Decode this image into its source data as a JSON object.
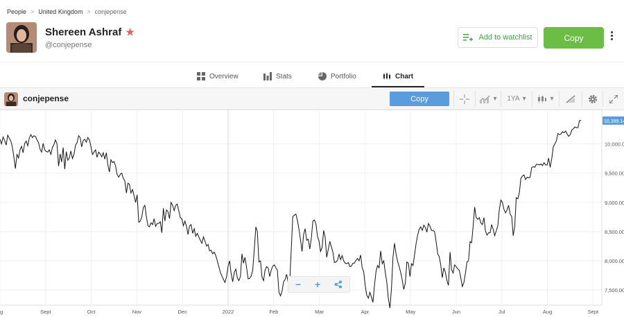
{
  "breadcrumb": {
    "items": [
      "People",
      "United Kingdom",
      "conjepense"
    ]
  },
  "profile": {
    "name": "Shereen Ashraf",
    "handle": "@conjepense"
  },
  "actions": {
    "watchlist_label": "Add to watchlist",
    "copy_label": "Copy"
  },
  "tabs": [
    {
      "label": "Overview",
      "icon": "overview-icon"
    },
    {
      "label": "Stats",
      "icon": "stats-icon"
    },
    {
      "label": "Portfolio",
      "icon": "portfolio-icon"
    },
    {
      "label": "Chart",
      "icon": "chart-icon",
      "active": true
    }
  ],
  "chart_header": {
    "title": "conjepense",
    "copy_label": "Copy",
    "period_label": "1YA",
    "tools": [
      "crosshair-icon",
      "chart-type-icon",
      "period-selector",
      "candlestick-icon",
      "draw-icon",
      "gear-icon",
      "expand-icon"
    ]
  },
  "colors": {
    "accent_green": "#6bbd46",
    "accent_blue": "#5a9cdc",
    "star": "#e0605a"
  },
  "chart_data": {
    "type": "line",
    "title": "",
    "xlabel": "",
    "ylabel": "",
    "x_ticks": [
      "g",
      "Sept",
      "Oct",
      "Nov",
      "Dec",
      "2022",
      "Feb",
      "Mar",
      "Apr",
      "May",
      "Jun",
      "Jul",
      "Aug",
      "Sept"
    ],
    "y_ticks": [
      "10,000.00",
      "9,500.00",
      "9,000.00",
      "8,500.00",
      "8,000.00",
      "7,500.00"
    ],
    "current_value_label": "10,399.14",
    "ylim": [
      7240,
      10600
    ],
    "series": [
      {
        "values": [
          10080,
          10000,
          10120,
          10060,
          9980,
          10150,
          10100,
          10050,
          9950,
          9780,
          9580,
          9820,
          9760,
          9900,
          9960,
          9850,
          10010,
          10050,
          9970,
          10100,
          10160,
          10110,
          10140,
          10130,
          10070,
          10020,
          9910,
          9860,
          10010,
          9900,
          9870,
          9860,
          9900,
          9820,
          9940,
          9990,
          10070,
          10000,
          9620,
          9830,
          9690,
          9940,
          9570,
          9870,
          9720,
          9760,
          9880,
          9750,
          9820,
          9980,
          10020,
          10140,
          10110,
          9950,
          10060,
          10080,
          10030,
          10110,
          10070,
          9960,
          9820,
          9860,
          9900,
          9770,
          9860,
          9830,
          9780,
          9850,
          9740,
          9850,
          9640,
          9520,
          9730,
          9680,
          9700,
          9620,
          9480,
          9430,
          9480,
          9500,
          9410,
          9370,
          9160,
          9330,
          9310,
          9160,
          9220,
          9110,
          9000,
          9130,
          8660,
          8680,
          8750,
          8910,
          8950,
          8750,
          8600,
          8580,
          8650,
          8620,
          8720,
          8590,
          8640,
          8640,
          8670,
          8480,
          8900,
          8680,
          8870,
          8840,
          8720,
          9000,
          8950,
          8860,
          8950,
          8970,
          8860,
          8740,
          8720,
          8600,
          8680,
          8590,
          8450,
          8600,
          8620,
          8470,
          8550,
          8420,
          8470,
          8410,
          8350,
          8300,
          8410,
          8340,
          8250,
          8280,
          8170,
          8180,
          8120,
          8150,
          8090,
          8000,
          7900,
          7800,
          7740,
          7680,
          7630,
          7730,
          7910,
          8000,
          7780,
          7640,
          7800,
          7860,
          7710,
          7660,
          7730,
          8120,
          7960,
          8060,
          7890,
          7690,
          7700,
          7740,
          7840,
          8200,
          8580,
          8500,
          7980,
          8000,
          7720,
          7660,
          7840,
          7900,
          7880,
          7730,
          7840,
          7910,
          7930,
          7880,
          7840,
          7460,
          7400,
          7480,
          7640,
          7680,
          7770,
          7620,
          7640,
          8200,
          8760,
          8780,
          8800,
          8690,
          8540,
          8360,
          8160,
          8450,
          8550,
          8350,
          8370,
          8200,
          8380,
          8680,
          8700,
          8630,
          8420,
          8340,
          8160,
          8230,
          8520,
          8400,
          8060,
          8200,
          8330,
          8240,
          8150,
          7970,
          7980,
          8010,
          8110,
          8020,
          8090,
          8000,
          7960,
          7950,
          7970,
          7900,
          7910,
          7960,
          7960,
          8010,
          8040,
          8000,
          8100,
          7880,
          7810,
          7570,
          7410,
          7360,
          7460,
          7380,
          7290,
          7580,
          7820,
          7920,
          7880,
          8170,
          7950,
          8000,
          7800,
          7630,
          7360,
          7190,
          7520,
          8060,
          8300,
          8110,
          7990,
          7900,
          7800,
          7670,
          7510,
          7620,
          7980,
          7960,
          7730,
          7950,
          7920,
          8100,
          8300,
          8440,
          8540,
          8580,
          8520,
          8610,
          8570,
          8490,
          8640,
          8590,
          8520,
          8520,
          8500,
          8320,
          8120,
          8070,
          7930,
          7710,
          7880,
          7800,
          7660,
          7580,
          8150,
          7850,
          7790,
          7930,
          7900,
          7860,
          7840,
          7710,
          7560,
          7630,
          7790,
          7980,
          8000,
          8330,
          8310,
          8590,
          8920,
          8740,
          8710,
          8740,
          8650,
          8620,
          8740,
          8510,
          8440,
          8480,
          8480,
          8620,
          8540,
          8430,
          8510,
          8600,
          8880,
          9040,
          9000,
          8880,
          8820,
          8870,
          8950,
          8800,
          8760,
          8430,
          8590,
          9080,
          9060,
          9170,
          9410,
          9450,
          9470,
          9390,
          9430,
          9420,
          9430,
          9600,
          9610,
          9600,
          9650,
          9650,
          9640,
          9660,
          9630,
          9680,
          9640,
          9640,
          9760,
          9600,
          9750,
          9950,
          10000,
          10050,
          10180,
          10160,
          10170,
          10210,
          10190,
          10220,
          10170,
          10130,
          10160,
          10240,
          10260,
          10290,
          10280,
          10280,
          10400,
          10400
        ]
      }
    ],
    "grid": true,
    "y_axis_position": "right"
  }
}
